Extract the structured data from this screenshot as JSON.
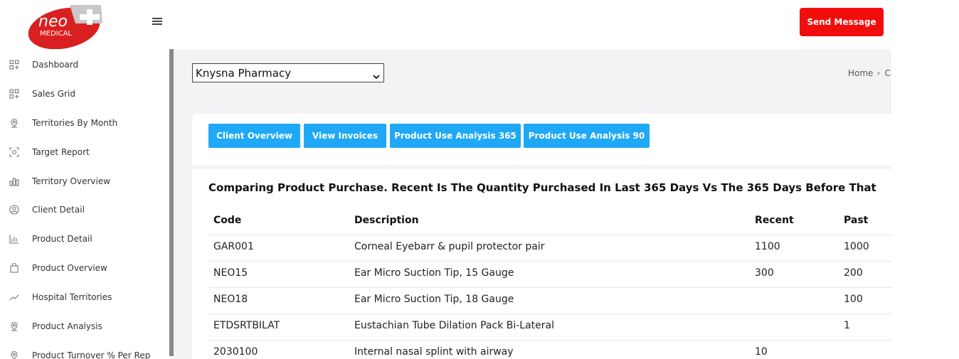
{
  "brand": {
    "logo_text": "neo MEDICAL",
    "logo_colors": {
      "red": "#d92020",
      "silver": "#c8c8c8"
    }
  },
  "header": {
    "menu_icon": "hamburger-icon",
    "send_message_label": "Send Message",
    "accent": "#f20d0d"
  },
  "sidebar": {
    "items": [
      {
        "label": "Dashboard",
        "icon": "grid-plus-icon"
      },
      {
        "label": "Sales Grid",
        "icon": "grid-plus-icon"
      },
      {
        "label": "Territories By Month",
        "icon": "map-pin-icon"
      },
      {
        "label": "Target Report",
        "icon": "target-icon"
      },
      {
        "label": "Territory Overview",
        "icon": "bar-chart-icon"
      },
      {
        "label": "Client Detail",
        "icon": "user-circle-icon"
      },
      {
        "label": "Product Detail",
        "icon": "column-chart-icon"
      },
      {
        "label": "Product Overview",
        "icon": "shopping-bag-icon"
      },
      {
        "label": "Hospital Territories",
        "icon": "trend-line-icon"
      },
      {
        "label": "Product Analysis",
        "icon": "map-pin-icon"
      },
      {
        "label": "Product Turnover % Per Rep",
        "icon": "map-pin-icon"
      }
    ]
  },
  "client_select": {
    "value": "Knysna Pharmacy"
  },
  "breadcrumb": {
    "home": "Home",
    "current": "Cl"
  },
  "tabs": [
    {
      "label": "Client Overview"
    },
    {
      "label": "View Invoices"
    },
    {
      "label": "Product Use Analysis 365"
    },
    {
      "label": "Product Use Analysis 90"
    }
  ],
  "tab_color": "#1fa8f5",
  "section_title": "Comparing Product Purchase. Recent Is The Quantity Purchased In Last 365 Days Vs The 365 Days Before That",
  "table": {
    "headers": {
      "code": "Code",
      "description": "Description",
      "recent": "Recent",
      "past": "Past"
    },
    "rows": [
      {
        "code": "GAR001",
        "description": "Corneal Eyebarr & pupil protector pair",
        "recent": "1100",
        "past": "1000"
      },
      {
        "code": "NEO15",
        "description": "Ear Micro Suction Tip, 15 Gauge",
        "recent": "300",
        "past": "200"
      },
      {
        "code": "NEO18",
        "description": "Ear Micro Suction Tip, 18 Gauge",
        "recent": "",
        "past": "100"
      },
      {
        "code": "ETDSRTBILAT",
        "description": "Eustachian Tube Dilation Pack Bi-Lateral",
        "recent": "",
        "past": "1"
      },
      {
        "code": "2030100",
        "description": "Internal nasal splint with airway",
        "recent": "10",
        "past": ""
      }
    ]
  }
}
